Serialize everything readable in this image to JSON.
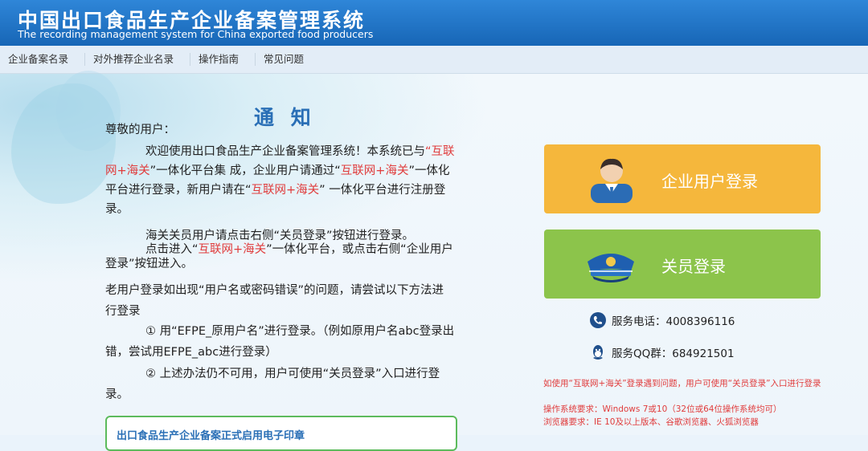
{
  "header": {
    "title_cn": "中国出口食品生产企业备案管理系统",
    "title_en": "The recording management system for China exported food producers"
  },
  "nav": {
    "items": [
      "企业备案名录",
      "对外推荐企业名录",
      "操作指南",
      "常见问题"
    ]
  },
  "notice": {
    "title": "通 知",
    "greeting": "尊敬的用户：",
    "p1_a": "欢迎使用出口食品生产企业备案管理系统！本系统已与",
    "p1_r1": "“互联网+海关",
    "p1_b": "”一体化平台集 成，企业用户请通过“",
    "p1_r2": "互联网+海关",
    "p1_c": "”一体化平台进行登录，新用户请在“",
    "p1_r3": "互联网+海关",
    "p1_d": "” 一体化平台进行注册登录。",
    "p2": "海关关员用户请点击右侧“关员登录”按钮进行登录。",
    "p3_a": "点击进入“",
    "p3_r": "互联网+海关",
    "p3_b": "”一体化平台，或点击右侧“企业用户登录”按钮进入。",
    "p4": "老用户登录如出现“用户名或密码错误”的问题，请尝试以下方法进行登录",
    "p5": "① 用“EFPE_原用户名”进行登录。（例如原用户名abc登录出错，尝试用EFPE_abc进行登录）",
    "p6": "② 上述办法仍不可用，用户可使用“关员登录”入口进行登录。",
    "box_title": "出口食品生产企业备案正式启用电子印章"
  },
  "panel": {
    "enterprise_login": "企业用户登录",
    "customs_login": "关员登录",
    "phone_label": "服务电话：4008396116",
    "qq_label": "服务QQ群：684921501",
    "tip1": "如使用“互联网+海关”登录遇到问题，用户可使用“关员登录”入口进行登录",
    "tip2": "操作系统要求：Windows 7或10（32位或64位操作系统均可）",
    "tip3": "浏览器要求：IE 10及以上版本、谷歌浏览器、火狐浏览器"
  },
  "colors": {
    "header": "#1f72c1",
    "enterprise_button": "#f5b73c",
    "customs_button": "#8cc44b",
    "red_text": "#e03c3c",
    "notice_title": "#2a6fb6"
  }
}
